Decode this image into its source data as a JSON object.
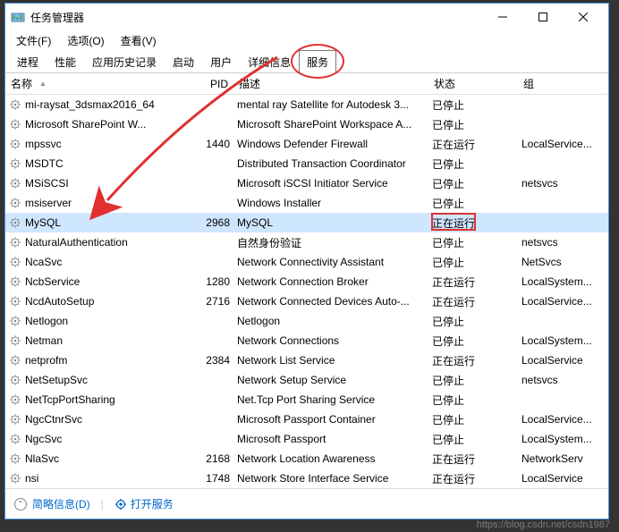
{
  "window": {
    "title": "任务管理器"
  },
  "menu": {
    "file": "文件(F)",
    "options": "选项(O)",
    "view": "查看(V)"
  },
  "tabs": {
    "processes": "进程",
    "performance": "性能",
    "apphistory": "应用历史记录",
    "startup": "启动",
    "users": "用户",
    "details": "详细信息",
    "services": "服务"
  },
  "columns": {
    "name": "名称",
    "pid": "PID",
    "desc": "描述",
    "status": "状态",
    "group": "组"
  },
  "rows": [
    {
      "name": "mi-raysat_3dsmax2016_64",
      "pid": "",
      "desc": "mental ray Satellite for Autodesk 3...",
      "status": "已停止",
      "group": ""
    },
    {
      "name": "Microsoft SharePoint W...",
      "pid": "",
      "desc": "Microsoft SharePoint Workspace A...",
      "status": "已停止",
      "group": ""
    },
    {
      "name": "mpssvc",
      "pid": "1440",
      "desc": "Windows Defender Firewall",
      "status": "正在运行",
      "group": "LocalService..."
    },
    {
      "name": "MSDTC",
      "pid": "",
      "desc": "Distributed Transaction Coordinator",
      "status": "已停止",
      "group": ""
    },
    {
      "name": "MSiSCSI",
      "pid": "",
      "desc": "Microsoft iSCSI Initiator Service",
      "status": "已停止",
      "group": "netsvcs"
    },
    {
      "name": "msiserver",
      "pid": "",
      "desc": "Windows Installer",
      "status": "已停止",
      "group": ""
    },
    {
      "name": "MySQL",
      "pid": "2968",
      "desc": "MySQL",
      "status": "正在运行",
      "group": "",
      "selected": true
    },
    {
      "name": "NaturalAuthentication",
      "pid": "",
      "desc": "自然身份验证",
      "status": "已停止",
      "group": "netsvcs"
    },
    {
      "name": "NcaSvc",
      "pid": "",
      "desc": "Network Connectivity Assistant",
      "status": "已停止",
      "group": "NetSvcs"
    },
    {
      "name": "NcbService",
      "pid": "1280",
      "desc": "Network Connection Broker",
      "status": "正在运行",
      "group": "LocalSystem..."
    },
    {
      "name": "NcdAutoSetup",
      "pid": "2716",
      "desc": "Network Connected Devices Auto-...",
      "status": "正在运行",
      "group": "LocalService..."
    },
    {
      "name": "Netlogon",
      "pid": "",
      "desc": "Netlogon",
      "status": "已停止",
      "group": ""
    },
    {
      "name": "Netman",
      "pid": "",
      "desc": "Network Connections",
      "status": "已停止",
      "group": "LocalSystem..."
    },
    {
      "name": "netprofm",
      "pid": "2384",
      "desc": "Network List Service",
      "status": "正在运行",
      "group": "LocalService"
    },
    {
      "name": "NetSetupSvc",
      "pid": "",
      "desc": "Network Setup Service",
      "status": "已停止",
      "group": "netsvcs"
    },
    {
      "name": "NetTcpPortSharing",
      "pid": "",
      "desc": "Net.Tcp Port Sharing Service",
      "status": "已停止",
      "group": ""
    },
    {
      "name": "NgcCtnrSvc",
      "pid": "",
      "desc": "Microsoft Passport Container",
      "status": "已停止",
      "group": "LocalService..."
    },
    {
      "name": "NgcSvc",
      "pid": "",
      "desc": "Microsoft Passport",
      "status": "已停止",
      "group": "LocalSystem..."
    },
    {
      "name": "NlaSvc",
      "pid": "2168",
      "desc": "Network Location Awareness",
      "status": "正在运行",
      "group": "NetworkServ"
    },
    {
      "name": "nsi",
      "pid": "1748",
      "desc": "Network Store Interface Service",
      "status": "正在运行",
      "group": "LocalService"
    }
  ],
  "footer": {
    "brief": "简略信息(D)",
    "open": "打开服务"
  },
  "watermark": "https://blog.csdn.net/csdn1987"
}
